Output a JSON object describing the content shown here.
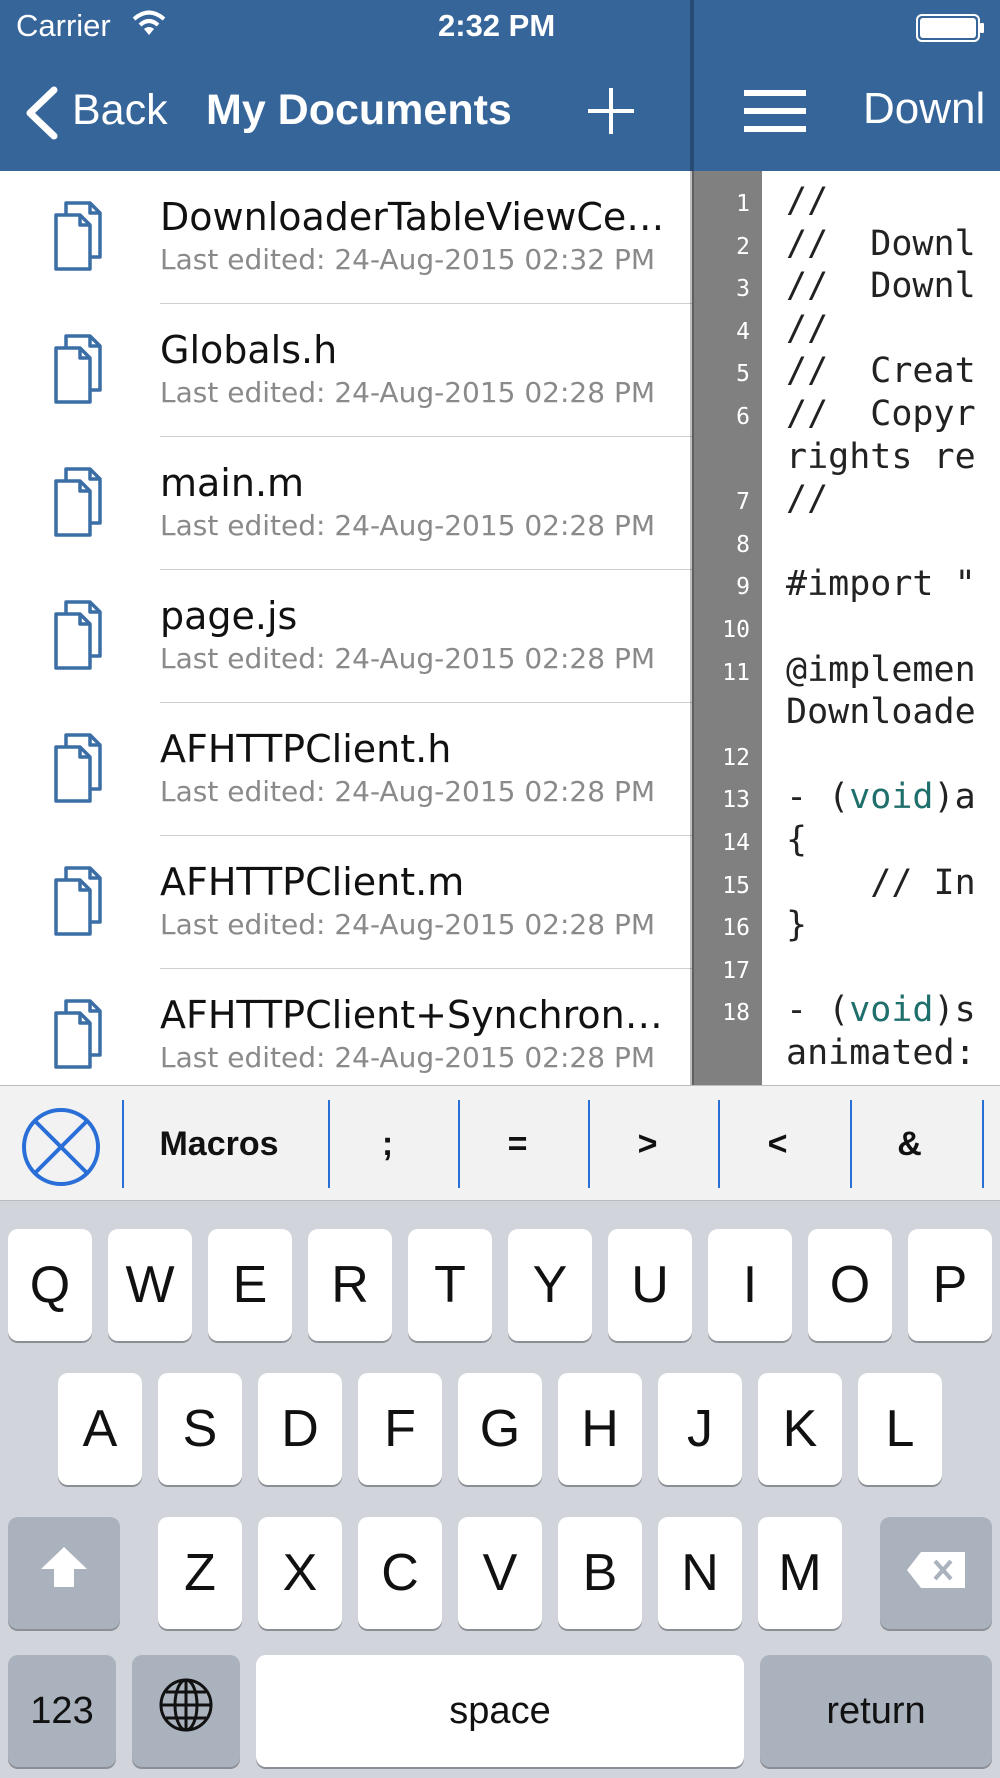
{
  "status_bar": {
    "carrier": "Carrier",
    "time": "2:32 PM"
  },
  "left_nav": {
    "back_label": "Back",
    "title": "My Documents"
  },
  "right_nav": {
    "title": "Downl"
  },
  "documents": [
    {
      "name": "DownloaderTableViewCe…",
      "date": "Last edited: 24-Aug-2015 02:32 PM"
    },
    {
      "name": "Globals.h",
      "date": "Last edited: 24-Aug-2015 02:28 PM"
    },
    {
      "name": "main.m",
      "date": "Last edited: 24-Aug-2015 02:28 PM"
    },
    {
      "name": "page.js",
      "date": "Last edited: 24-Aug-2015 02:28 PM"
    },
    {
      "name": "AFHTTPClient.h",
      "date": "Last edited: 24-Aug-2015 02:28 PM"
    },
    {
      "name": "AFHTTPClient.m",
      "date": "Last edited: 24-Aug-2015 02:28 PM"
    },
    {
      "name": "AFHTTPClient+Synchron…",
      "date": "Last edited: 24-Aug-2015 02:28 PM"
    }
  ],
  "editor": {
    "line_numbers": [
      "1",
      "2",
      "3",
      "4",
      "5",
      "6",
      "7",
      "8",
      "9",
      "10",
      "11",
      "12",
      "13",
      "14",
      "15",
      "16",
      "17",
      "18"
    ],
    "code_lines": [
      "//",
      "//  Downl",
      "//  Downl",
      "//",
      "//  Creat",
      "//  Copyr",
      "rights re",
      "//",
      "",
      "#import \"",
      "",
      "@implemen",
      "Downloade",
      "",
      "- (void)a",
      "{",
      "    // In",
      "}",
      "",
      "- (void)s",
      "animated:"
    ]
  },
  "accessory_bar": {
    "keys": [
      "Macros",
      ";",
      "=",
      ">",
      "<",
      "&"
    ]
  },
  "keyboard": {
    "row1": [
      "Q",
      "W",
      "E",
      "R",
      "T",
      "Y",
      "U",
      "I",
      "O",
      "P"
    ],
    "row2": [
      "A",
      "S",
      "D",
      "F",
      "G",
      "H",
      "J",
      "K",
      "L"
    ],
    "row3": [
      "Z",
      "X",
      "C",
      "V",
      "B",
      "N",
      "M"
    ],
    "numbers_label": "123",
    "space_label": "space",
    "return_label": "return"
  },
  "colors": {
    "nav_bar": "#36659a",
    "gutter": "#808080",
    "keyword": "#1f6f6c",
    "accessory_accent": "#2a6fd8"
  }
}
